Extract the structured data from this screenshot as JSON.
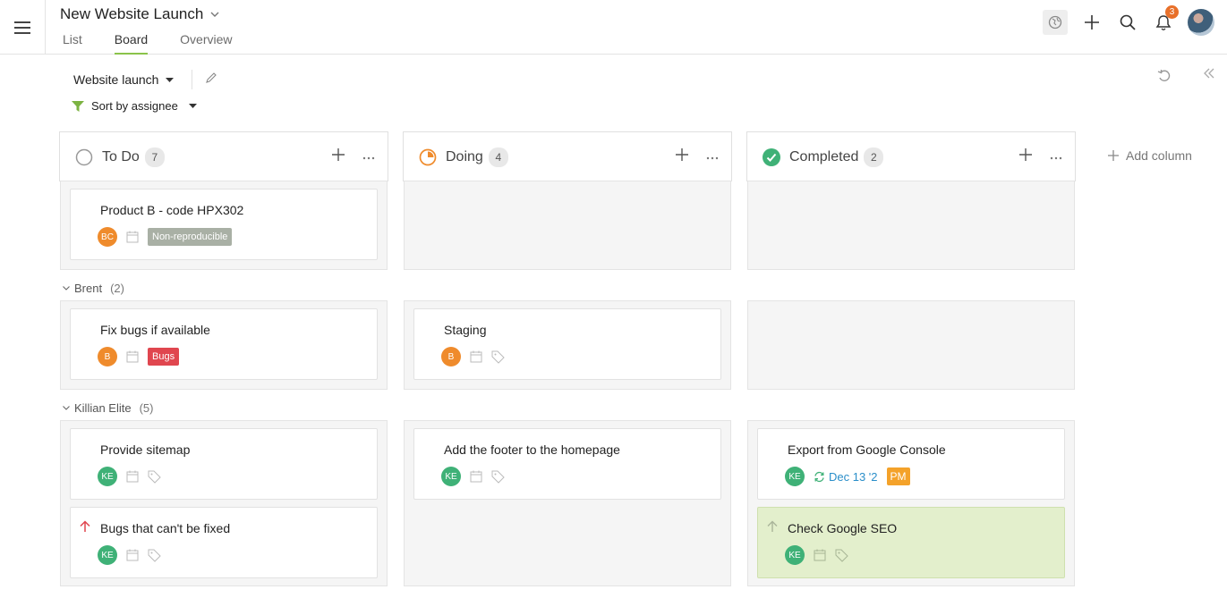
{
  "header": {
    "project_title": "New Website Launch",
    "tabs": [
      {
        "label": "List"
      },
      {
        "label": "Board"
      },
      {
        "label": "Overview"
      }
    ],
    "notification_count": "3"
  },
  "toolbar": {
    "board_name": "Website launch",
    "sort_label": "Sort by assignee"
  },
  "columns": [
    {
      "title": "To Do",
      "count": "7"
    },
    {
      "title": "Doing",
      "count": "4"
    },
    {
      "title": "Completed",
      "count": "2"
    }
  ],
  "add_column_label": "Add column",
  "groups": [
    {
      "name": "Brent",
      "count": "(2)"
    },
    {
      "name": "Killian Elite",
      "count": "(5)"
    }
  ],
  "cards": {
    "c1": {
      "title": "Product B - code HPX302",
      "avatar": "BC",
      "tag": "Non-reproducible"
    },
    "c2": {
      "title": "Fix bugs if available",
      "avatar": "B",
      "tag": "Bugs"
    },
    "c3": {
      "title": "Staging",
      "avatar": "B"
    },
    "c4": {
      "title": "Provide sitemap",
      "avatar": "KE"
    },
    "c5": {
      "title": "Bugs that can't be fixed",
      "avatar": "KE"
    },
    "c6": {
      "title": "Add the footer to the homepage",
      "avatar": "KE"
    },
    "c7": {
      "title": "Export from Google Console",
      "avatar": "KE",
      "due": "Dec 13 '2",
      "tag": "PM"
    },
    "c8": {
      "title": "Check Google SEO",
      "avatar": "KE"
    }
  },
  "colors": {
    "accent": "#8bc34a",
    "doing": "#ef8b2c",
    "completed": "#3fb177",
    "bugs": "#e0464f"
  }
}
